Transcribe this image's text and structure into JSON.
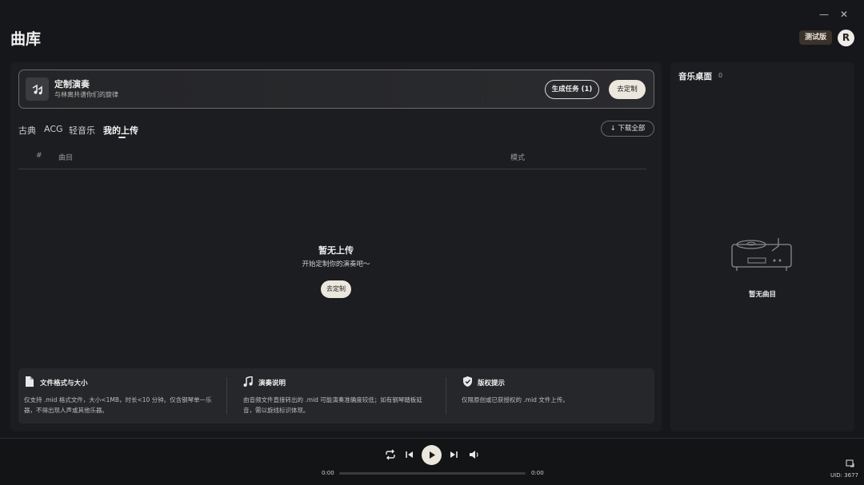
{
  "window": {
    "minimize_glyph": "—",
    "close_glyph": "✕"
  },
  "header": {
    "title": "曲库",
    "trial_badge": "测试版",
    "avatar_initial": "R"
  },
  "banner": {
    "icon": "piano-music-icon",
    "title": "定制演奏",
    "subtitle": "与林离共谱你们的旋律",
    "generate_button": "生成任务 (1)",
    "customize_button": "去定制"
  },
  "tabs": [
    {
      "label": "古典",
      "active": false
    },
    {
      "label": "ACG",
      "active": false
    },
    {
      "label": "轻音乐",
      "active": false
    },
    {
      "label": "我的上传",
      "active": true
    }
  ],
  "download_all": "下载全部",
  "table": {
    "headers": [
      "#",
      "曲目",
      "模式"
    ]
  },
  "empty_state": {
    "title": "暂无上传",
    "subtitle": "开始定制你的演奏吧～",
    "button": "去定制"
  },
  "info": [
    {
      "icon": "file-icon",
      "title": "文件格式与大小",
      "text": "仅支持 .mid 格式文件，大小<1MB，时长<10 分钟。仅含钢琴单一乐器，不得出现人声或其他乐器。"
    },
    {
      "icon": "music-note-icon",
      "title": "演奏说明",
      "text": "由音频文件直接转出的 .mid 可能演奏准确度较低；如有钢琴踏板延音，需以旋线标识体现。"
    },
    {
      "icon": "shield-check-icon",
      "title": "版权提示",
      "text": "仅限原创或已获授权的 .mid 文件上传。"
    }
  ],
  "sidebar": {
    "title": "音乐桌面",
    "count": "0",
    "empty_text": "暂无曲目"
  },
  "player": {
    "current_time": "0:00",
    "total_time": "0:00",
    "progress": 0,
    "uid": "UID: 3677"
  }
}
